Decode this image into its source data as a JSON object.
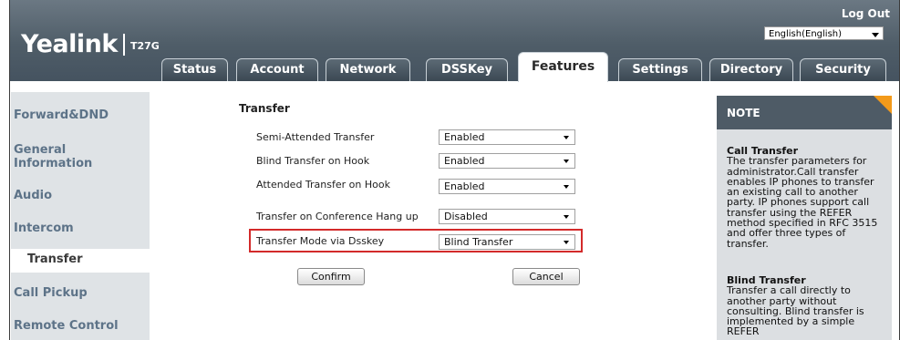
{
  "header": {
    "logo": "Yealink",
    "model": "T27G",
    "logout": "Log Out",
    "language": "English(English)"
  },
  "tabs": [
    "Status",
    "Account",
    "Network",
    "DSSKey",
    "Features",
    "Settings",
    "Directory",
    "Security"
  ],
  "active_tab": "Features",
  "sidebar": {
    "items": [
      "Forward&DND",
      "General Information",
      "Audio",
      "Intercom",
      "Transfer",
      "Call Pickup",
      "Remote Control"
    ],
    "active": "Transfer"
  },
  "main": {
    "section_title": "Transfer",
    "rows": [
      {
        "label": "Semi-Attended Transfer",
        "value": "Enabled"
      },
      {
        "label": "Blind Transfer on Hook",
        "value": "Enabled"
      },
      {
        "label": "Attended Transfer on Hook",
        "value": "Enabled"
      },
      {
        "label": "Transfer on Conference Hang up",
        "value": "Disabled"
      },
      {
        "label": "Transfer Mode via Dsskey",
        "value": "Blind Transfer"
      }
    ],
    "confirm": "Confirm",
    "cancel": "Cancel"
  },
  "note": {
    "title": "NOTE",
    "sections": [
      {
        "heading": "Call Transfer",
        "text": "The transfer parameters for administrator.Call transfer enables IP phones to transfer an existing call to another party. IP phones support call transfer using the REFER method specified in RFC 3515 and offer three types of transfer."
      },
      {
        "heading": "Blind Transfer",
        "text": "Transfer a call directly to another party without consulting. Blind transfer is implemented by a simple REFER"
      }
    ]
  },
  "colors": {
    "header": "#4f5d68",
    "highlight": "#d32a2a",
    "note_corner": "#f39a1a",
    "sidebar_text": "#5d7388"
  }
}
